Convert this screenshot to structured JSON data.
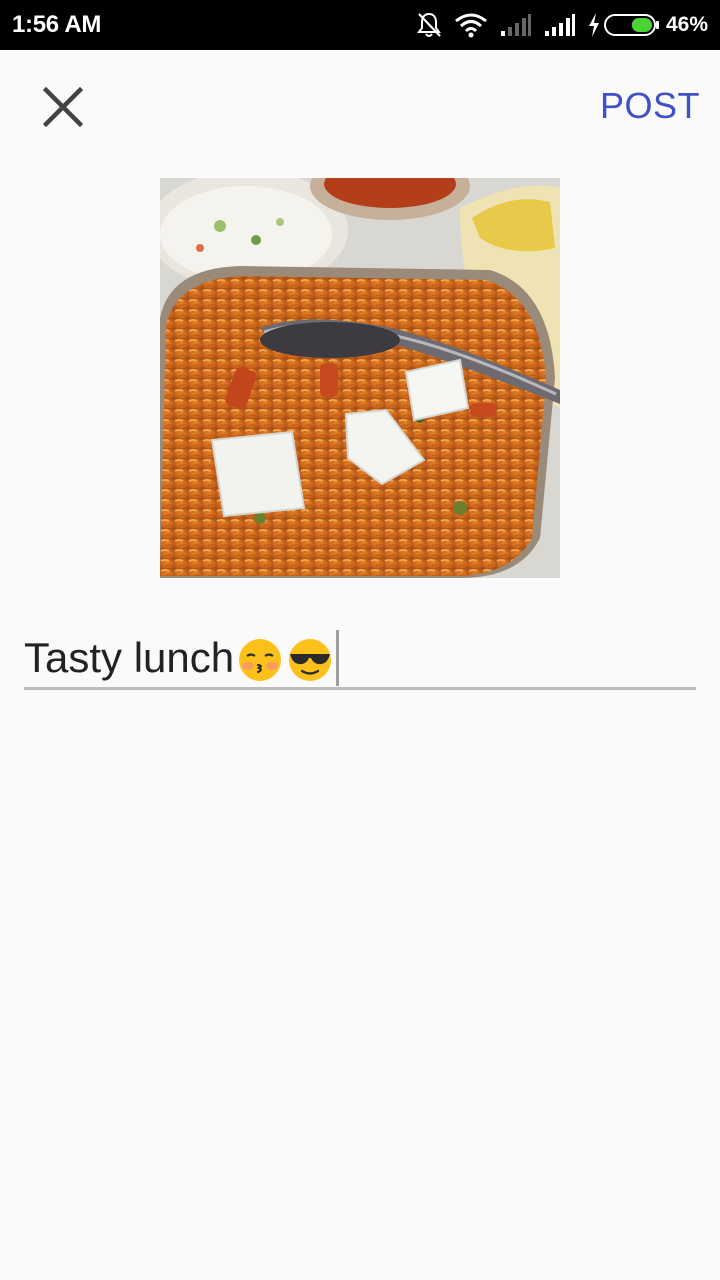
{
  "status_bar": {
    "time": "1:56 AM",
    "battery_percent": "46%",
    "battery_level": 0.46,
    "icons": [
      "notifications-off-icon",
      "wifi-icon",
      "signal-icon",
      "signal-icon",
      "charging-icon",
      "battery-icon"
    ]
  },
  "toolbar": {
    "close_icon": "close-icon",
    "post_label": "POST",
    "accent_color": "#3f51c5"
  },
  "photo": {
    "subject": "plate of vegetable biryani with paneer cubes, raita and papad"
  },
  "caption": {
    "value": "Tasty lunch",
    "emojis": [
      "kissing-face-emoji",
      "sunglasses-face-emoji"
    ]
  }
}
